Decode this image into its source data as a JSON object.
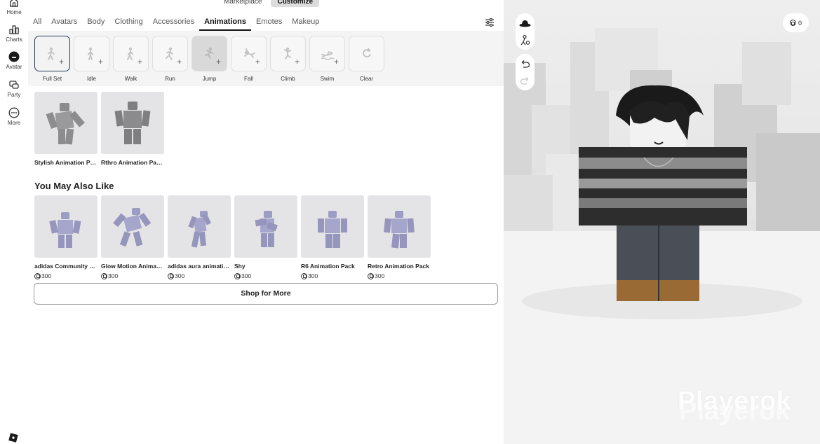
{
  "rail": {
    "items": [
      {
        "label": "Home",
        "icon": "home-icon"
      },
      {
        "label": "Charts",
        "icon": "charts-icon"
      },
      {
        "label": "Avatar",
        "icon": "avatar-icon"
      },
      {
        "label": "Party",
        "icon": "party-icon"
      },
      {
        "label": "More",
        "icon": "more-icon"
      }
    ]
  },
  "mode": {
    "marketplace": "Marketplace",
    "customize": "Customize"
  },
  "tabs": [
    "All",
    "Avatars",
    "Body",
    "Clothing",
    "Accessories",
    "Animations",
    "Emotes",
    "Makeup"
  ],
  "active_tab": "Animations",
  "slots": [
    "Full Set",
    "Idle",
    "Walk",
    "Run",
    "Jump",
    "Fall",
    "Climb",
    "Swim",
    "Clear"
  ],
  "owned": [
    {
      "name": "Stylish Animation Pack"
    },
    {
      "name": "Rthro Animation Package"
    }
  ],
  "recommend": {
    "title": "You May Also Like",
    "items": [
      {
        "name": "adidas Community Animation Pack",
        "price": "300"
      },
      {
        "name": "Glow Motion Animation Pack",
        "price": "300"
      },
      {
        "name": "adidas aura animation pack",
        "price": "300"
      },
      {
        "name": "Shy",
        "price": "300"
      },
      {
        "name": "R6 Animation Pack",
        "price": "300"
      },
      {
        "name": "Retro Animation Pack",
        "price": "300"
      }
    ]
  },
  "shop_button": "Shop for More",
  "viewport": {
    "robux_balance": "0",
    "watermark": "Playerok"
  },
  "colors": {
    "accent": "#111111",
    "thumb_bg": "#e4e4e6",
    "figure": "#9c9cbf"
  }
}
